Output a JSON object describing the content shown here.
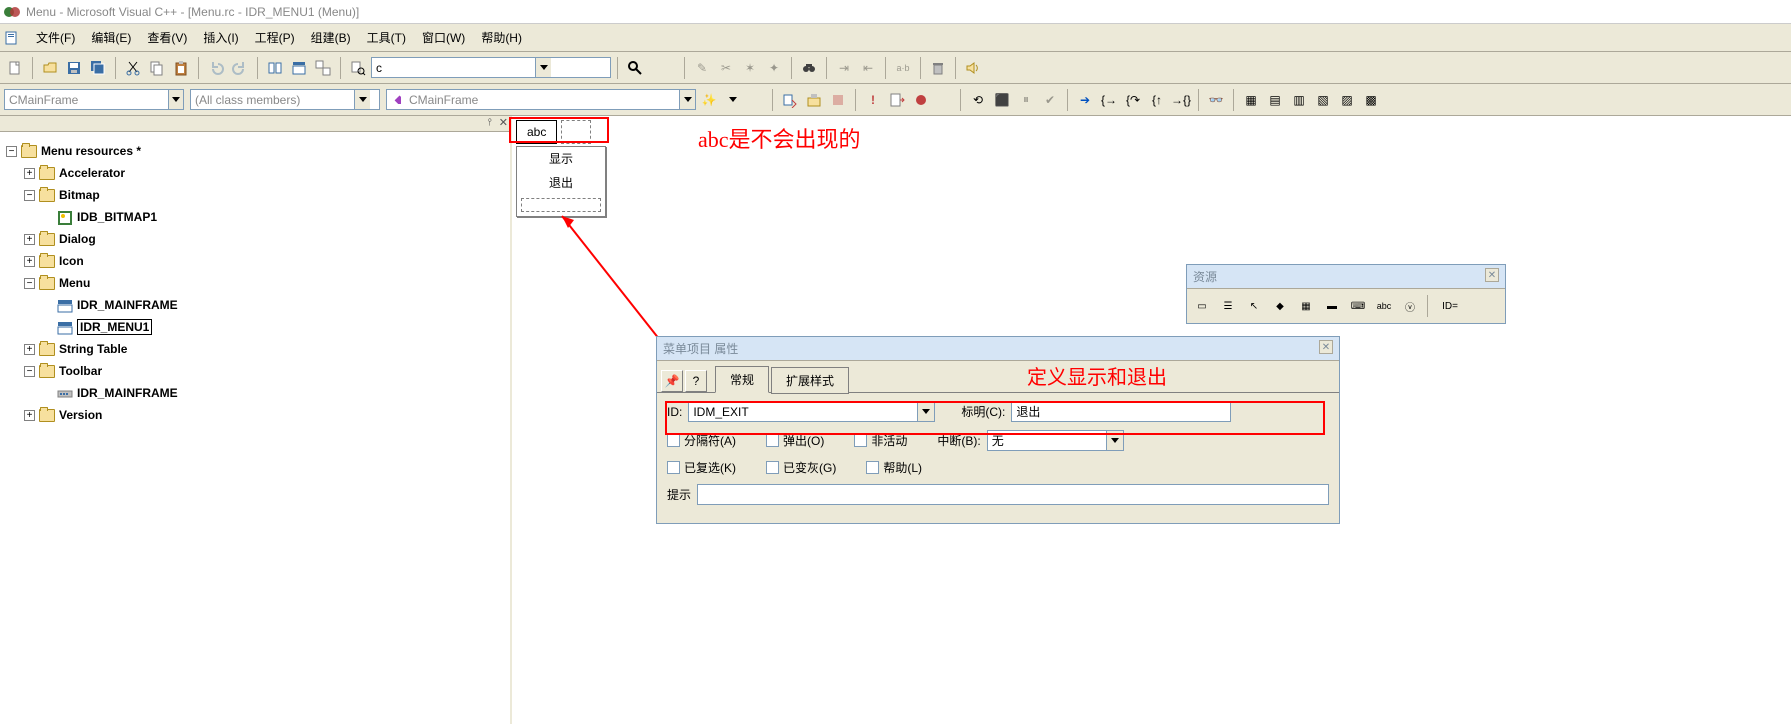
{
  "title": "Menu - Microsoft Visual C++ - [Menu.rc - IDR_MENU1 (Menu)]",
  "menubar": {
    "file": "文件(F)",
    "edit": "编辑(E)",
    "view": "查看(V)",
    "insert": "插入(I)",
    "project": "工程(P)",
    "build": "组建(B)",
    "tools": "工具(T)",
    "window": "窗口(W)",
    "help": "帮助(H)"
  },
  "tb2_search_value": "c",
  "wizbar": {
    "class": "CMainFrame",
    "filter": "(All class members)",
    "member": "CMainFrame"
  },
  "tree": {
    "root": "Menu resources *",
    "accelerator": "Accelerator",
    "bitmap": "Bitmap",
    "idb": "IDB_BITMAP1",
    "dialog": "Dialog",
    "icon": "Icon",
    "menu": "Menu",
    "mainframe": "IDR_MAINFRAME",
    "menu1": "IDR_MENU1",
    "stringtable": "String Table",
    "toolbar": "Toolbar",
    "tb_mainframe": "IDR_MAINFRAME",
    "version": "Version"
  },
  "menu_editor": {
    "head": "abc",
    "item1": "显示",
    "item2": "退出"
  },
  "annotations": {
    "a1": "abc是不会出现的",
    "a2": "定义显示和退出"
  },
  "res_panel": {
    "title": "资源",
    "id_label": "ID="
  },
  "prop": {
    "title": "菜单项目 属性",
    "tab_general": "常规",
    "tab_ext": "扩展样式",
    "id_label": "ID:",
    "id_value": "IDM_EXIT",
    "caption_label": "标明(C):",
    "caption_value": "退出",
    "separator": "分隔符(A)",
    "popup": "弹出(O)",
    "inactive": "非活动",
    "break_label": "中断(B):",
    "break_value": "无",
    "checked": "已复选(K)",
    "grayed": "已变灰(G)",
    "help": "帮助(L)",
    "prompt": "提示"
  }
}
